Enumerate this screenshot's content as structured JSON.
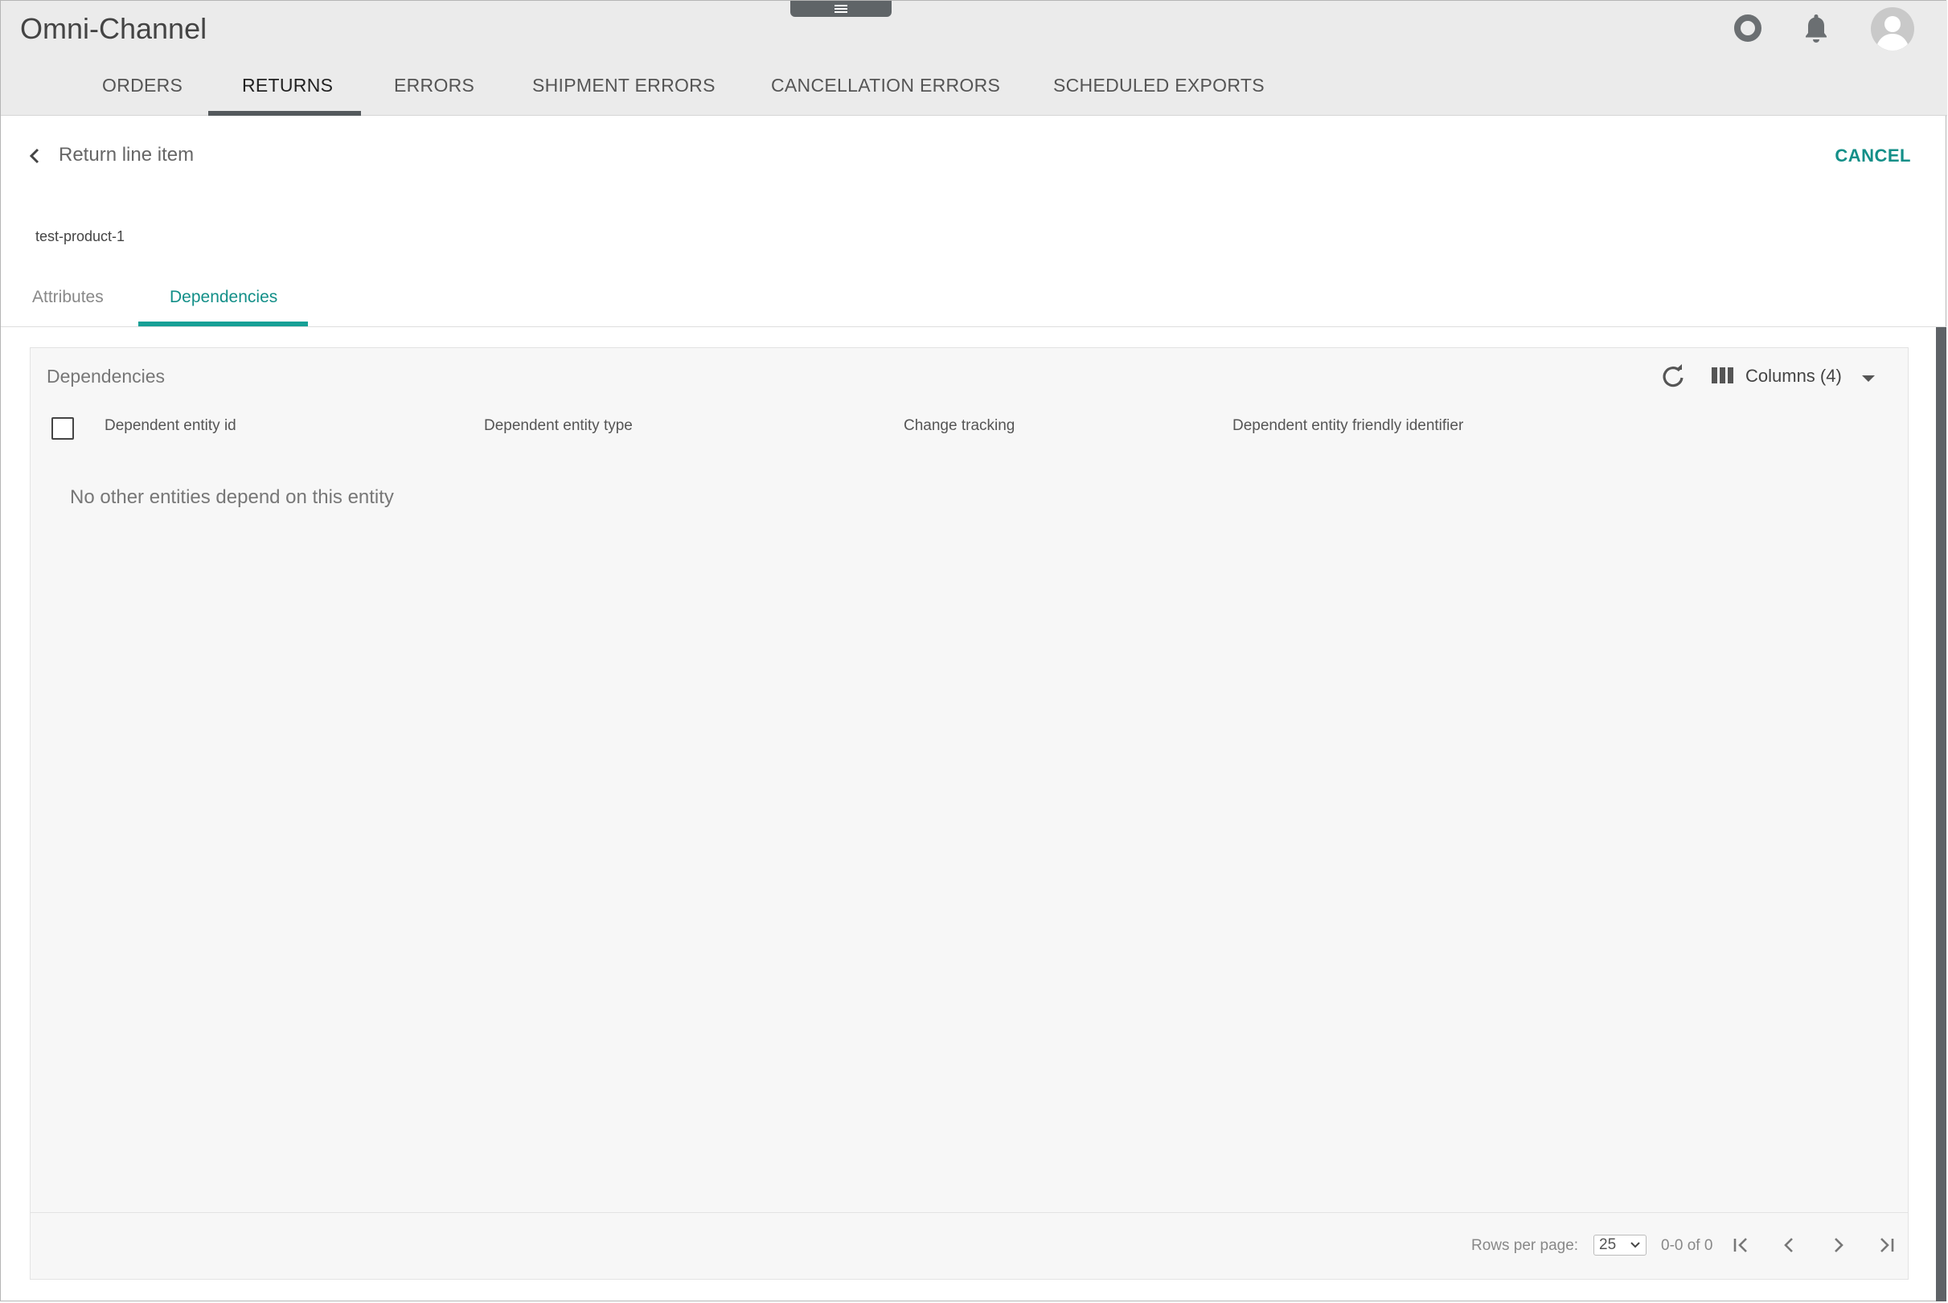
{
  "app": {
    "title": "Omni-Channel"
  },
  "nav": {
    "tabs": [
      {
        "label": "ORDERS"
      },
      {
        "label": "RETURNS"
      },
      {
        "label": "ERRORS"
      },
      {
        "label": "SHIPMENT ERRORS"
      },
      {
        "label": "CANCELLATION ERRORS"
      },
      {
        "label": "SCHEDULED EXPORTS"
      }
    ],
    "active_tab": "RETURNS"
  },
  "header_icons": [
    "help-ring-icon",
    "bell-icon",
    "user-avatar-icon"
  ],
  "page": {
    "title": "Return line item",
    "cancel_label": "CANCEL",
    "entity_name": "test-product-1",
    "subtabs": [
      {
        "label": "Attributes"
      },
      {
        "label": "Dependencies"
      }
    ],
    "active_subtab": "Dependencies"
  },
  "table": {
    "title": "Dependencies",
    "columns_label": "Columns (4)",
    "headers": [
      "Dependent entity id",
      "Dependent entity type",
      "Change tracking",
      "Dependent entity friendly identifier"
    ],
    "empty_message": "No other entities depend on this entity",
    "rows": []
  },
  "pagination": {
    "rows_per_page_label": "Rows per page:",
    "rows_per_page_value": "25",
    "range": "0-0 of 0"
  },
  "colors": {
    "accent": "#138f88",
    "header_bg": "#ebebeb",
    "nav_underline": "#54595c"
  }
}
